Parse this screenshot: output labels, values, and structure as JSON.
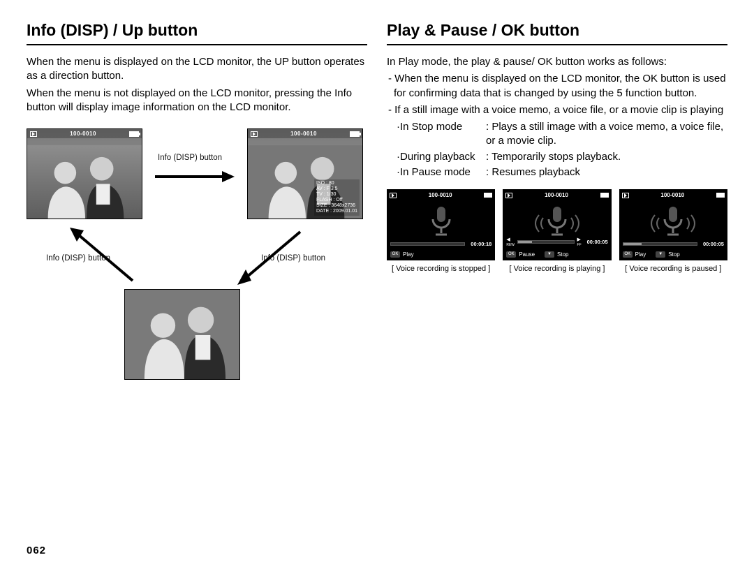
{
  "page_number": "062",
  "left": {
    "title": "Info (DISP) / Up button",
    "para1": "When the menu is displayed on the LCD monitor, the UP button operates as a direction button.",
    "para2": "When the menu is not displayed on the LCD monitor, pressing the Info button will display image information on the LCD monitor.",
    "label_top": "Info (DISP) button",
    "label_left": "Info (DISP) button",
    "label_right": "Info (DISP) button",
    "thumb_counter": "100-0010",
    "info_overlay": {
      "iso": "ISO   : 80",
      "av": "AV    : F 3.5",
      "tv": "TV    : 1/30",
      "flash": "FLASH : Off",
      "size": "SIZE  : 3648x2736",
      "date": "DATE  : 2009.01.01"
    }
  },
  "right": {
    "title": "Play & Pause / OK button",
    "intro": "In Play mode, the play & pause/ OK button works as follows:",
    "bullet1": "- When the menu is displayed on the LCD monitor, the OK button is used for confirming data that is changed by using the 5 function button.",
    "bullet2": "- If a still image with a voice memo, a voice file, or a movie clip is playing",
    "modes": [
      {
        "label": "·In Stop mode",
        "desc": ": Plays a still image with a voice memo, a voice file, or a movie clip."
      },
      {
        "label": "·During playback",
        "desc": ": Temporarily stops playback."
      },
      {
        "label": "·In Pause mode",
        "desc": ": Resumes playback"
      }
    ],
    "shots": [
      {
        "counter": "100-0010",
        "time": "00:00:18",
        "fill_pct": 0,
        "has_seek": false,
        "controls": [
          {
            "key": "OK",
            "label": "Play"
          }
        ],
        "caption": "[ Voice recording is stopped ]",
        "waves": false
      },
      {
        "counter": "100-0010",
        "time": "00:00:05",
        "fill_pct": 25,
        "has_seek": true,
        "controls": [
          {
            "key": "OK",
            "label": "Pause"
          },
          {
            "key": "▼",
            "label": "Stop"
          }
        ],
        "caption": "[ Voice recording is playing ]",
        "waves": true
      },
      {
        "counter": "100-0010",
        "time": "00:00:05",
        "fill_pct": 25,
        "has_seek": false,
        "controls": [
          {
            "key": "OK",
            "label": "Play"
          },
          {
            "key": "▼",
            "label": "Stop"
          }
        ],
        "caption": "[ Voice recording is paused ]",
        "waves": true
      }
    ]
  }
}
